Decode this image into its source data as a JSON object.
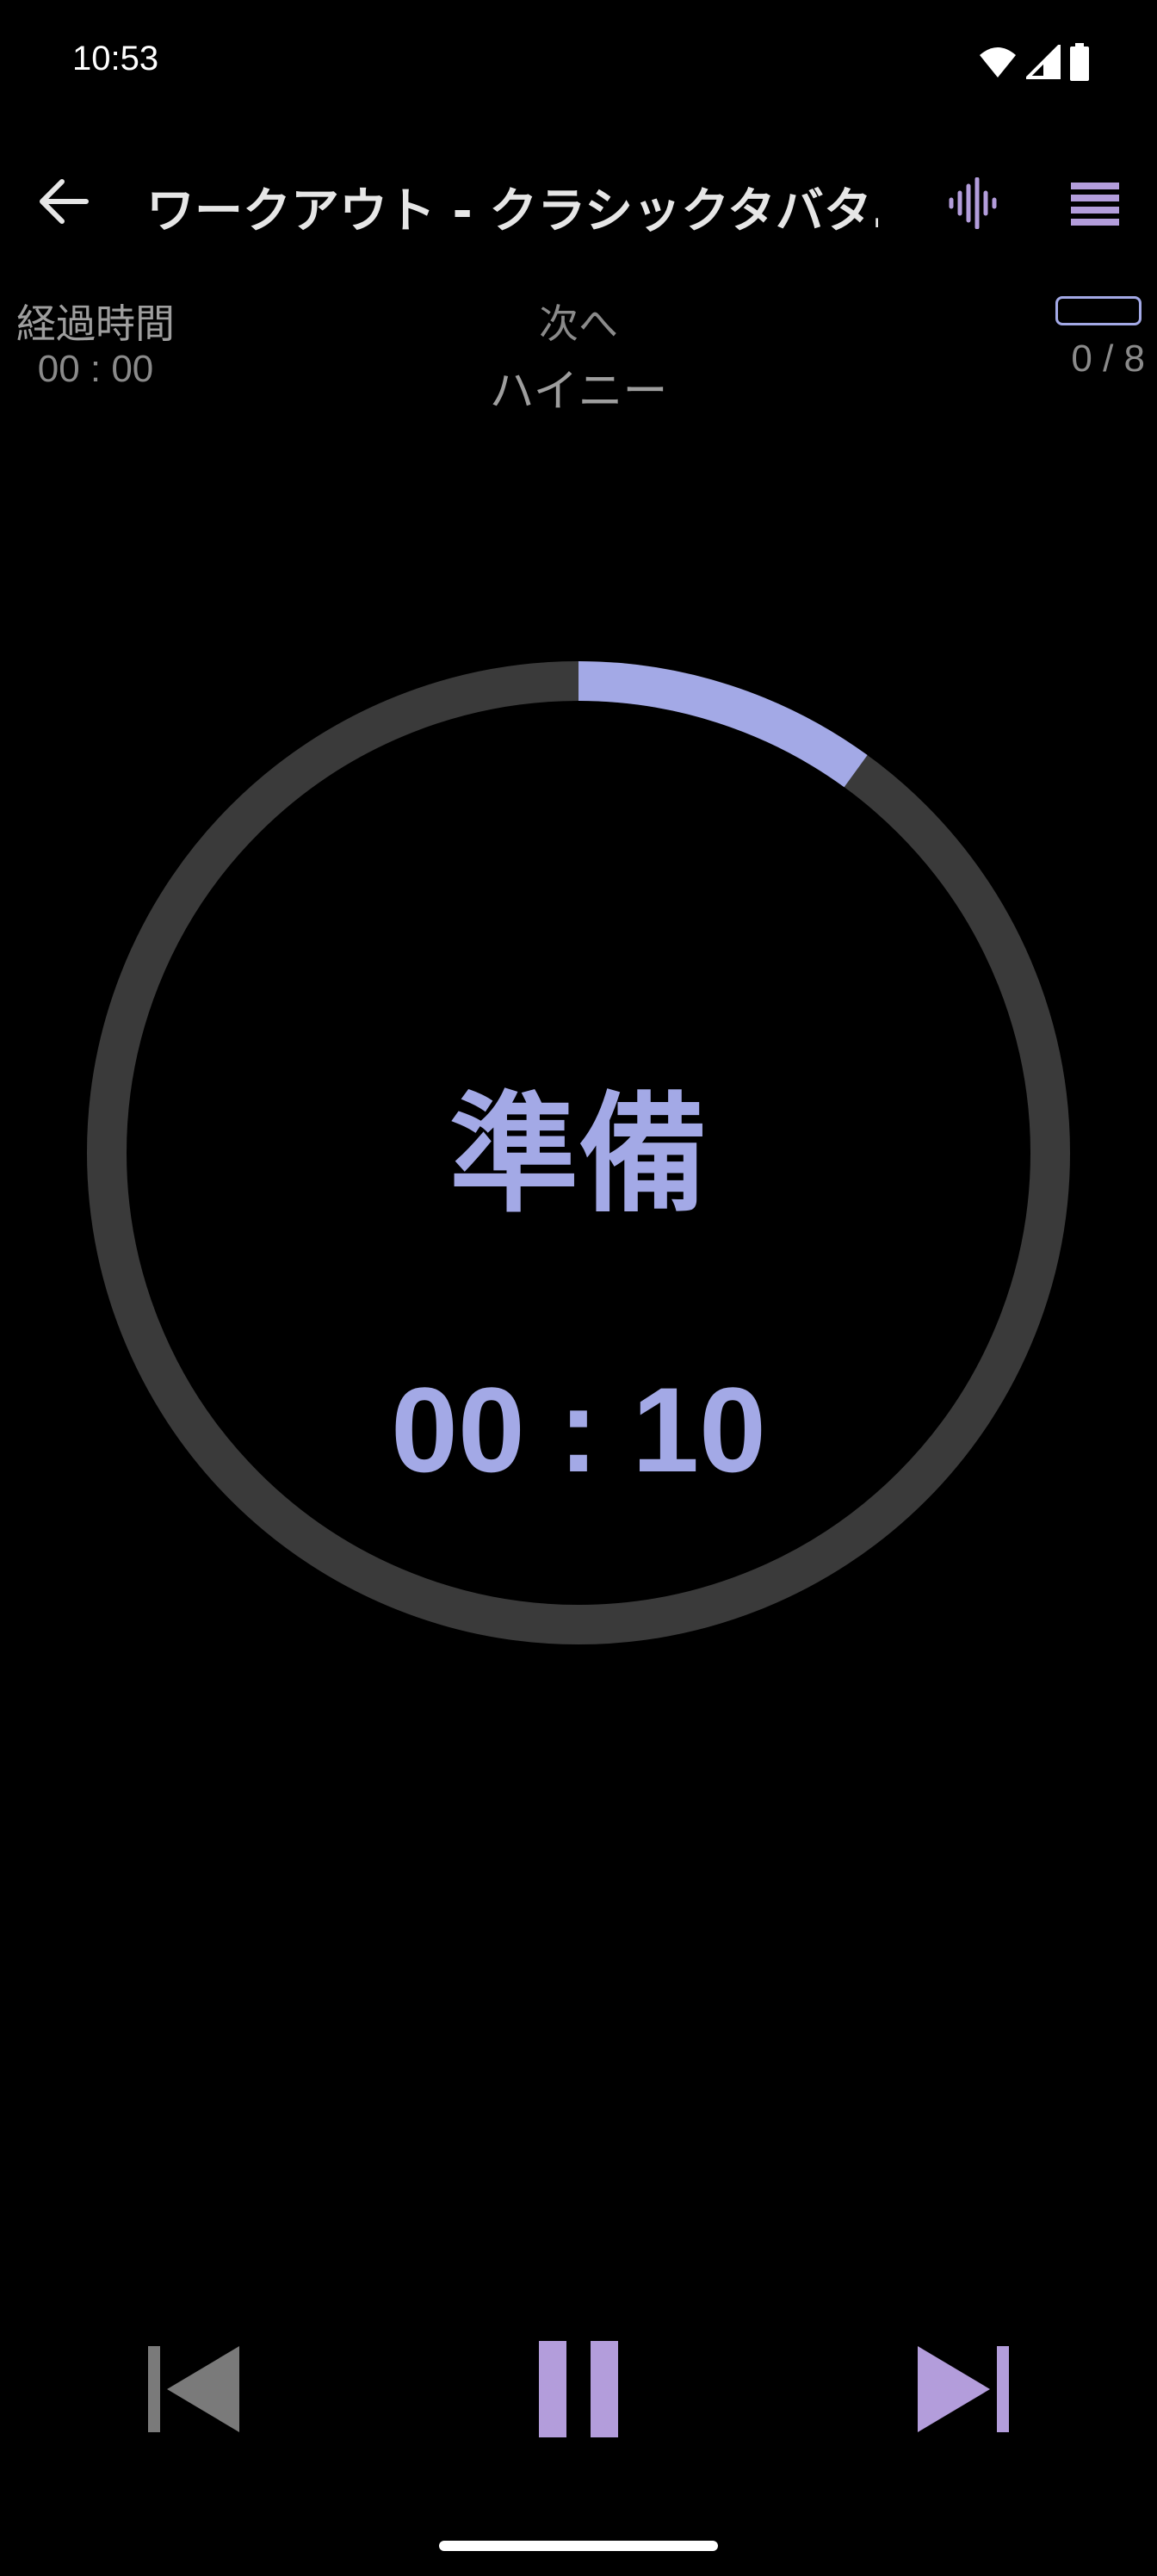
{
  "status_bar": {
    "time": "10:53",
    "icons": [
      "wifi-icon",
      "signal-icon",
      "battery-icon"
    ]
  },
  "app_bar": {
    "title": "ワークアウト - クラシックタバタ…",
    "back_icon": "arrow-left-icon",
    "voice_icon": "sound-wave-icon",
    "menu_icon": "menu-icon"
  },
  "info": {
    "elapsed_label": "経過時間",
    "elapsed_value": "00 : 00",
    "next_label": "次へ",
    "next_value": "ハイニー",
    "round_count": "0 / 8"
  },
  "timer": {
    "phase": "準備",
    "countdown": "00 : 10",
    "progress": 0.1
  },
  "controls": {
    "prev_icon": "skip-previous-icon",
    "pause_icon": "pause-icon",
    "next_icon": "skip-next-icon"
  },
  "colors": {
    "accent": "#a3a9e6",
    "accent_purple": "#b39ddb",
    "track": "#3a3a3a",
    "muted_text": "#8a8a8a",
    "disabled_control": "#7a7a7a"
  }
}
